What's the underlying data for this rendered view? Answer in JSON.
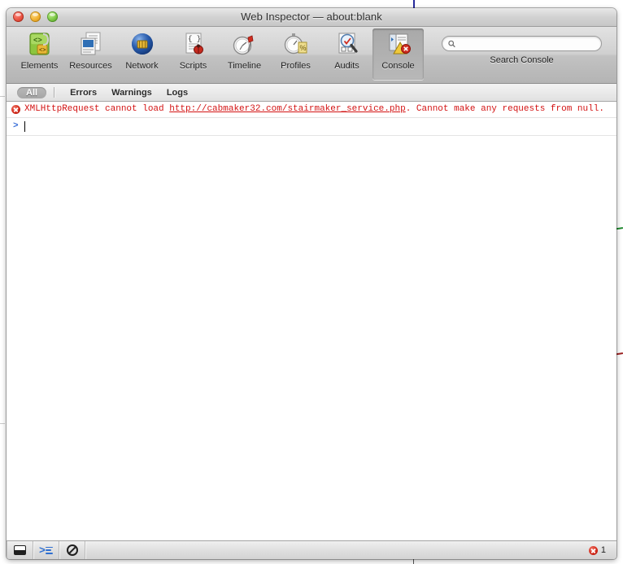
{
  "window": {
    "title": "Web Inspector — about:blank",
    "controls": [
      {
        "name": "close",
        "color": "#e8513f"
      },
      {
        "name": "minimize",
        "color": "#efae2c"
      },
      {
        "name": "zoom",
        "color": "#79c442"
      }
    ]
  },
  "toolbar": {
    "panels": [
      {
        "id": "elements",
        "label": "Elements",
        "icon": "elements-icon",
        "selected": false
      },
      {
        "id": "resources",
        "label": "Resources",
        "icon": "resources-icon",
        "selected": false
      },
      {
        "id": "network",
        "label": "Network",
        "icon": "network-icon",
        "selected": false
      },
      {
        "id": "scripts",
        "label": "Scripts",
        "icon": "scripts-icon",
        "selected": false
      },
      {
        "id": "timeline",
        "label": "Timeline",
        "icon": "timeline-icon",
        "selected": false
      },
      {
        "id": "profiles",
        "label": "Profiles",
        "icon": "profiles-icon",
        "selected": false
      },
      {
        "id": "audits",
        "label": "Audits",
        "icon": "audits-icon",
        "selected": false
      },
      {
        "id": "console",
        "label": "Console",
        "icon": "console-icon",
        "selected": true
      }
    ],
    "search": {
      "value": "",
      "placeholder": "",
      "caption": "Search Console",
      "icon": "search-icon"
    }
  },
  "filter_bar": {
    "items": [
      {
        "id": "all",
        "label": "All",
        "active": true
      },
      {
        "id": "errors",
        "label": "Errors",
        "active": false
      },
      {
        "id": "warnings",
        "label": "Warnings",
        "active": false
      },
      {
        "id": "logs",
        "label": "Logs",
        "active": false
      }
    ]
  },
  "console": {
    "messages": [
      {
        "level": "error",
        "icon": "error-icon",
        "text_before": "XMLHttpRequest cannot load ",
        "link": "http://cabmaker32.com/stairmaker_service.php",
        "text_after": ". Cannot make any requests from null."
      }
    ],
    "prompt": {
      "chevron": ">",
      "value": ""
    }
  },
  "statusbar": {
    "buttons": [
      {
        "id": "dock",
        "icon": "dock-to-bottom-icon"
      },
      {
        "id": "show-console",
        "icon": "console-prompt-icon"
      },
      {
        "id": "clear-console",
        "icon": "clear-circle-slash-icon"
      }
    ],
    "error_count": "1",
    "error_icon": "error-icon"
  },
  "colors": {
    "error_red": "#d31313",
    "prompt_blue": "#3a6fd8",
    "window_chrome": "#d0d0d0",
    "console_background": "#ffffff"
  }
}
